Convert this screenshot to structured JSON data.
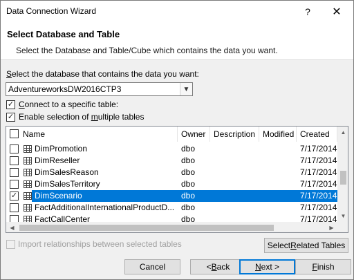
{
  "window": {
    "title": "Data Connection Wizard",
    "help": "?",
    "close": "✕"
  },
  "header": {
    "title": "Select Database and Table",
    "subtitle": "Select the Database and Table/Cube which contains the data you want."
  },
  "database": {
    "label_pre": "",
    "label_u": "S",
    "label_post": "elect the database that contains the data you want:",
    "value": "AdventureworksDW2016CTP3"
  },
  "options": {
    "connect_specific": {
      "pre": "",
      "u": "C",
      "post": "onnect to a specific table:",
      "checked": true
    },
    "enable_multiple": {
      "pre": "Enable selection of ",
      "u": "m",
      "post": "ultiple tables",
      "checked": true
    }
  },
  "table": {
    "columns": [
      "Name",
      "Owner",
      "Description",
      "Modified",
      "Created"
    ],
    "rows": [
      {
        "name": "DimPromotion",
        "owner": "dbo",
        "description": "",
        "modified": "",
        "created": "7/17/2014",
        "checked": false,
        "selected": false
      },
      {
        "name": "DimReseller",
        "owner": "dbo",
        "description": "",
        "modified": "",
        "created": "7/17/2014",
        "checked": false,
        "selected": false
      },
      {
        "name": "DimSalesReason",
        "owner": "dbo",
        "description": "",
        "modified": "",
        "created": "7/17/2014",
        "checked": false,
        "selected": false
      },
      {
        "name": "DimSalesTerritory",
        "owner": "dbo",
        "description": "",
        "modified": "",
        "created": "7/17/2014",
        "checked": false,
        "selected": false
      },
      {
        "name": "DimScenario",
        "owner": "dbo",
        "description": "",
        "modified": "",
        "created": "7/17/2014",
        "checked": true,
        "selected": true
      },
      {
        "name": "FactAdditionalInternationalProductD...",
        "owner": "dbo",
        "description": "",
        "modified": "",
        "created": "7/17/2014",
        "checked": false,
        "selected": false
      },
      {
        "name": "FactCallCenter",
        "owner": "dbo",
        "description": "",
        "modified": "",
        "created": "7/17/2014",
        "checked": false,
        "selected": false
      }
    ]
  },
  "import_relationships": {
    "label": "Import relationships between selected tables",
    "checked": false,
    "enabled": false
  },
  "buttons": {
    "select_related": {
      "pre": "Select ",
      "u": "R",
      "post": "elated Tables"
    },
    "cancel": "Cancel",
    "back": {
      "pre": "< ",
      "u": "B",
      "post": "ack"
    },
    "next": {
      "pre": "",
      "u": "N",
      "post": "ext >"
    },
    "finish": {
      "pre": "",
      "u": "F",
      "post": "inish"
    }
  },
  "colors": {
    "accent": "#0078d7",
    "selection": "#0078d7",
    "window_bg": "#f0f0f0"
  },
  "icons": {
    "table": "table-grid-icon",
    "check": "checkmark-icon"
  }
}
